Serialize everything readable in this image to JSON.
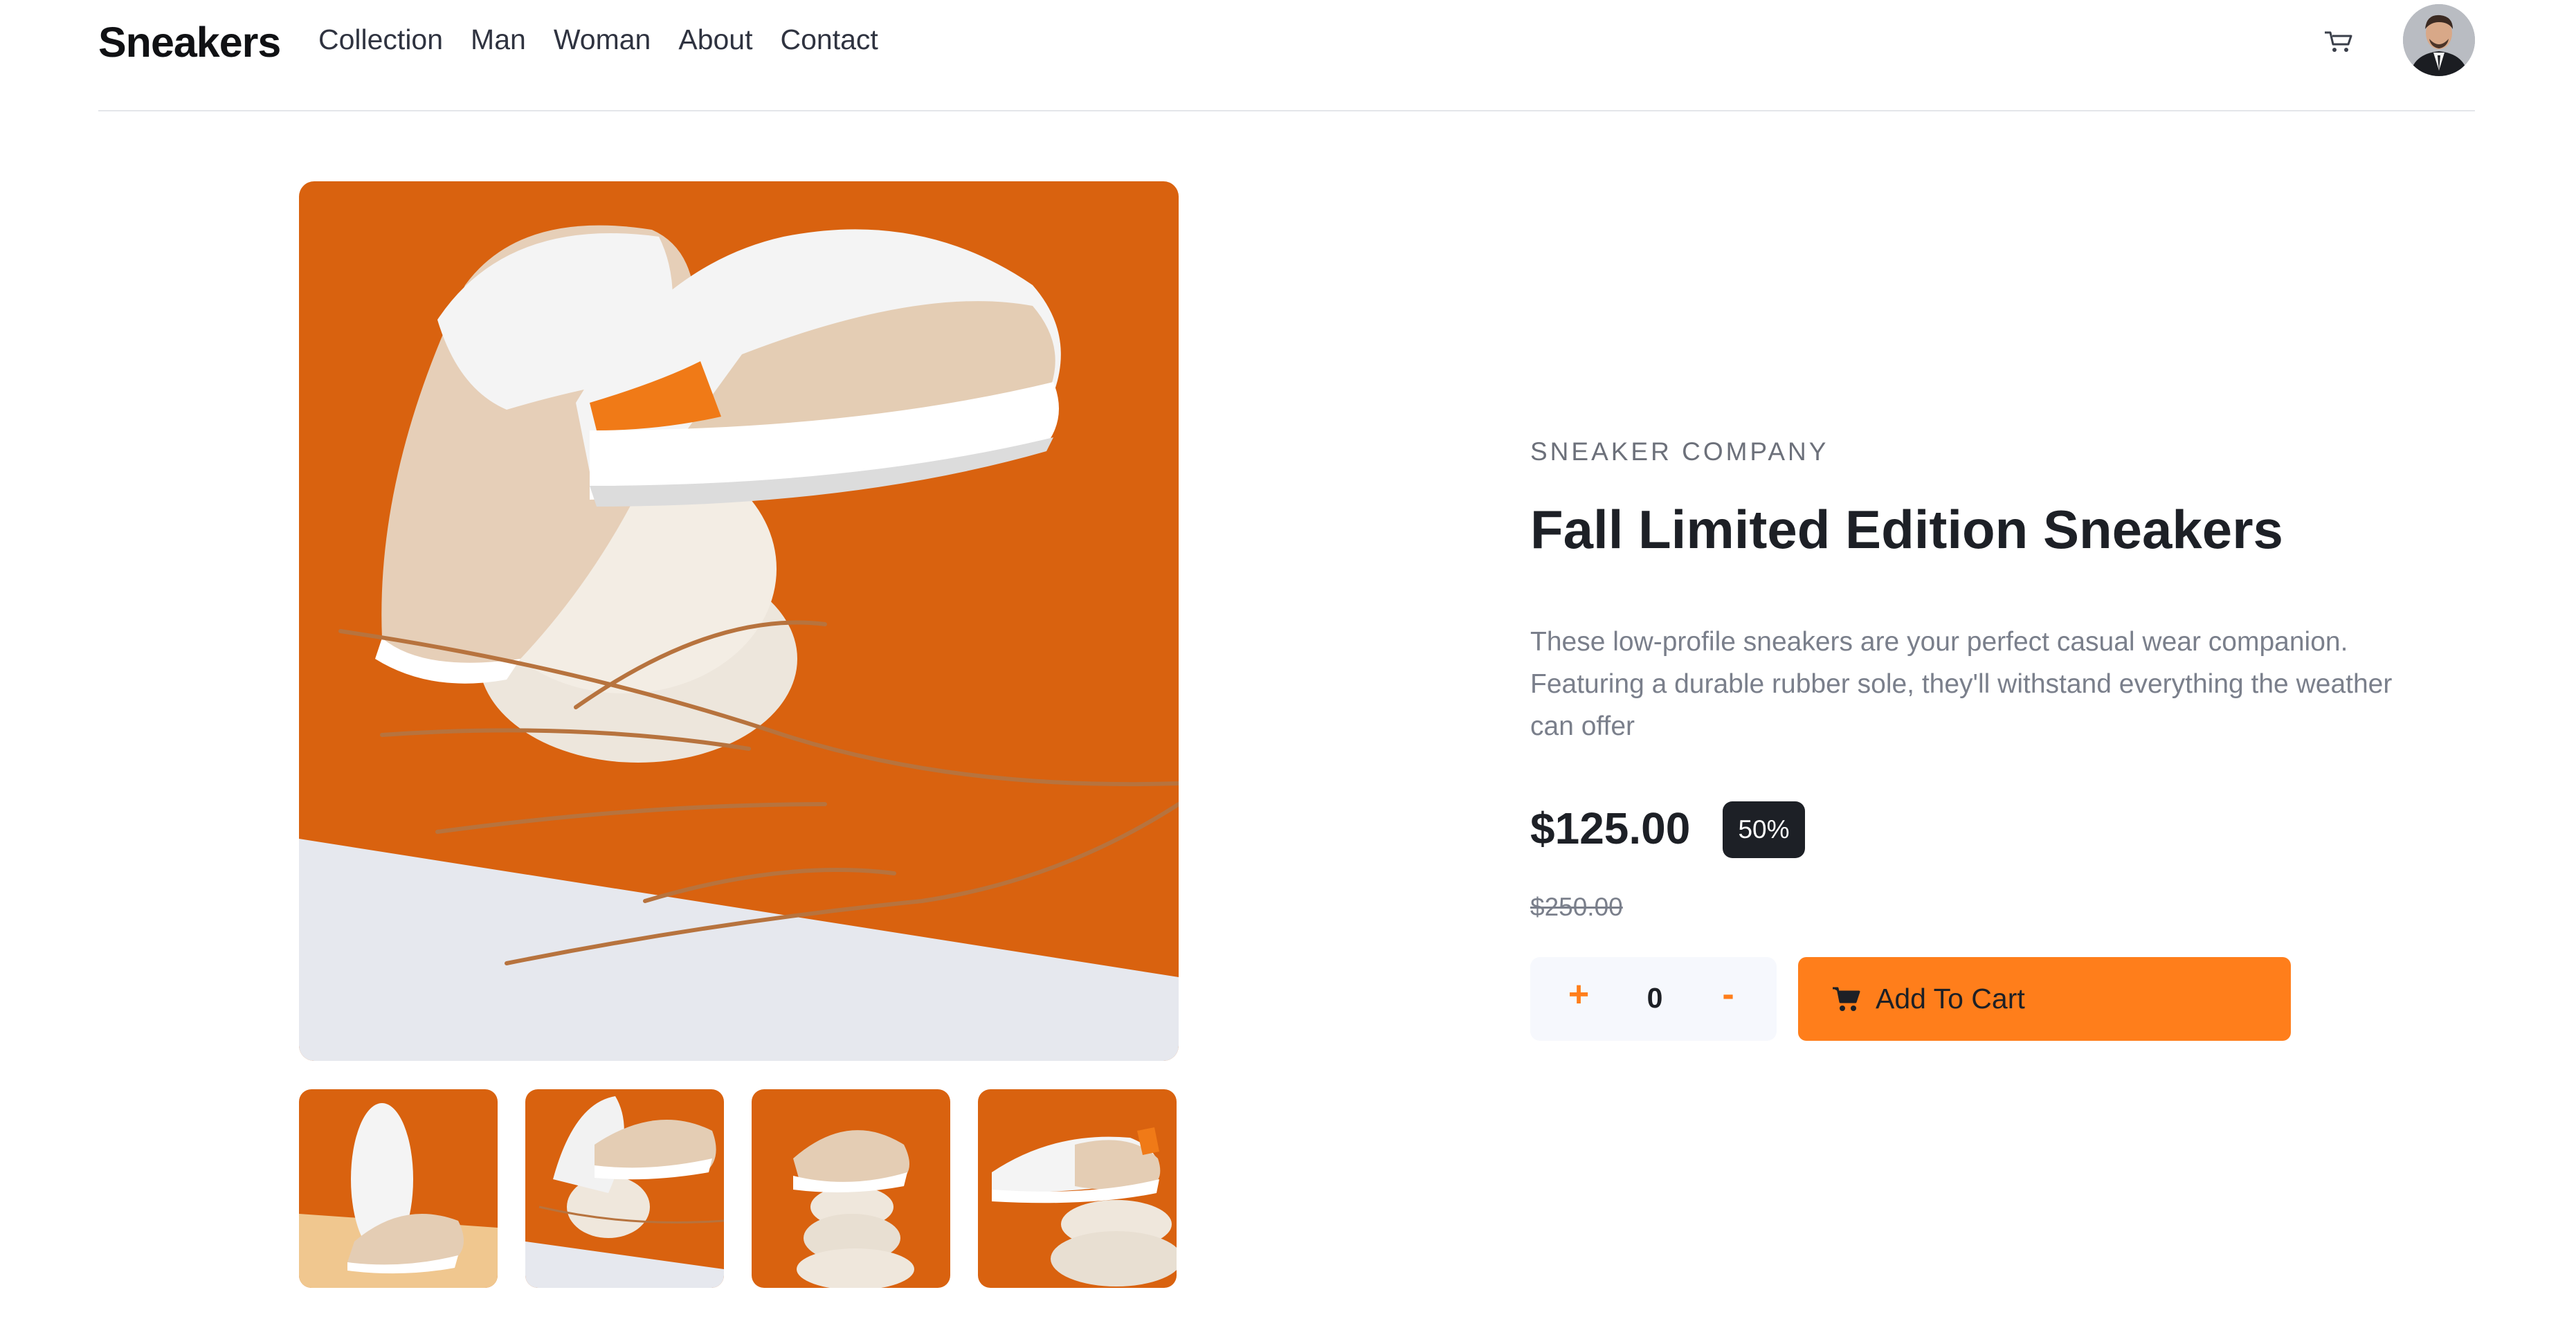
{
  "header": {
    "logo": "Sneakers",
    "nav": [
      "Collection",
      "Man",
      "Woman",
      "About",
      "Contact"
    ],
    "cart_icon": "cart-icon",
    "avatar_icon": "avatar"
  },
  "gallery": {
    "thumbnails_count": 4,
    "main_image_icon": "product-image"
  },
  "product": {
    "company": "SNEAKER COMPANY",
    "title": "Fall Limited Edition Sneakers",
    "description": "These low-profile sneakers are your perfect casual wear companion. Featuring a durable rubber sole, they'll withstand everything the weather can offer",
    "price": "$125.00",
    "discount": "50%",
    "original_price": "$250.00"
  },
  "cart_controls": {
    "increment_label": "+",
    "quantity": "0",
    "decrement_label": "-",
    "add_to_cart_label": "Add To Cart"
  },
  "colors": {
    "accent": "#ff7e1b",
    "dark": "#1d2026",
    "muted": "#7a7f8b",
    "light_bg": "#f6f8fd",
    "product_orange": "#d9620f"
  }
}
